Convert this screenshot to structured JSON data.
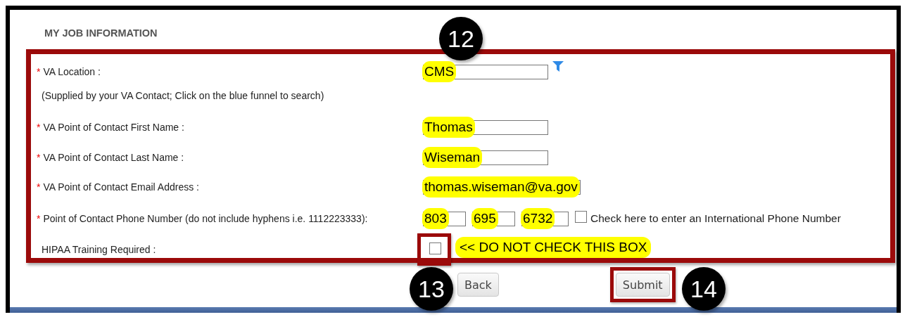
{
  "section_title": "MY JOB INFORMATION",
  "fields": [
    {
      "kind": "lookup",
      "marker": "*",
      "label": "VA Location :",
      "value": "CMS",
      "highlighted": true
    },
    {
      "kind": "note",
      "text": "(Supplied by your VA Contact; Click on the blue funnel to search)"
    },
    {
      "kind": "text",
      "marker": "*",
      "label": "VA Point of Contact First Name :",
      "value": "Thomas",
      "highlighted": true
    },
    {
      "kind": "text",
      "marker": "*",
      "label": "VA Point of Contact Last Name :",
      "value": "Wiseman",
      "highlighted": true
    },
    {
      "kind": "text",
      "marker": "*",
      "label": "VA Point of Contact Email Address :",
      "value": "thomas.wiseman@va.gov",
      "highlighted": true
    },
    {
      "kind": "phone",
      "marker": "*",
      "label": "Point of Contact Phone Number (do not include hyphens i.e. 1112223333):",
      "parts": [
        "803",
        "695",
        "6732"
      ],
      "highlighted": true,
      "option": {
        "label": "Check here to enter an International Phone Number",
        "checked": false
      }
    },
    {
      "kind": "checkbox",
      "label": "HIPAA Training Required :",
      "checked": false,
      "framed": true,
      "note": "<< DO NOT CHECK THIS BOX",
      "highlighted": true
    }
  ],
  "buttons": [
    {
      "label": "Back",
      "framed": false
    },
    {
      "label": "Submit",
      "framed": true
    }
  ],
  "callouts": [
    {
      "number": "12"
    },
    {
      "number": "13"
    },
    {
      "number": "14"
    }
  ]
}
